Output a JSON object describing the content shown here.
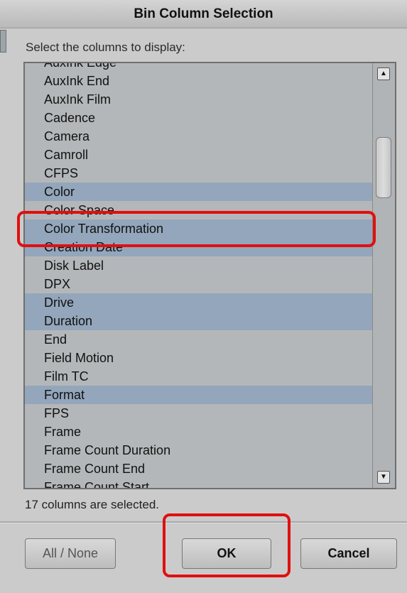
{
  "dialog": {
    "title": "Bin Column Selection",
    "prompt": "Select the columns to display:",
    "status": "17 columns are selected.",
    "buttons": {
      "all_none": "All / None",
      "ok": "OK",
      "cancel": "Cancel"
    }
  },
  "columns": [
    {
      "label": "AuxInk Edge",
      "selected": false
    },
    {
      "label": "AuxInk End",
      "selected": false
    },
    {
      "label": "AuxInk Film",
      "selected": false
    },
    {
      "label": "Cadence",
      "selected": false
    },
    {
      "label": "Camera",
      "selected": false
    },
    {
      "label": "Camroll",
      "selected": false
    },
    {
      "label": "CFPS",
      "selected": false
    },
    {
      "label": "Color",
      "selected": true
    },
    {
      "label": "Color Space",
      "selected": false
    },
    {
      "label": "Color Transformation",
      "selected": true
    },
    {
      "label": "Creation Date",
      "selected": true
    },
    {
      "label": "Disk Label",
      "selected": false
    },
    {
      "label": "DPX",
      "selected": false
    },
    {
      "label": "Drive",
      "selected": true
    },
    {
      "label": "Duration",
      "selected": true
    },
    {
      "label": "End",
      "selected": false
    },
    {
      "label": "Field Motion",
      "selected": false
    },
    {
      "label": "Film TC",
      "selected": false
    },
    {
      "label": "Format",
      "selected": true
    },
    {
      "label": "FPS",
      "selected": false
    },
    {
      "label": "Frame",
      "selected": false
    },
    {
      "label": "Frame Count Duration",
      "selected": false
    },
    {
      "label": "Frame Count End",
      "selected": false
    },
    {
      "label": "Frame Count Start",
      "selected": false
    }
  ],
  "scrollbar": {
    "up_icon": "arrow-up-icon",
    "down_icon": "arrow-down-icon"
  },
  "colors": {
    "selected_row": "#93a6bb",
    "highlight": "#e01010"
  }
}
